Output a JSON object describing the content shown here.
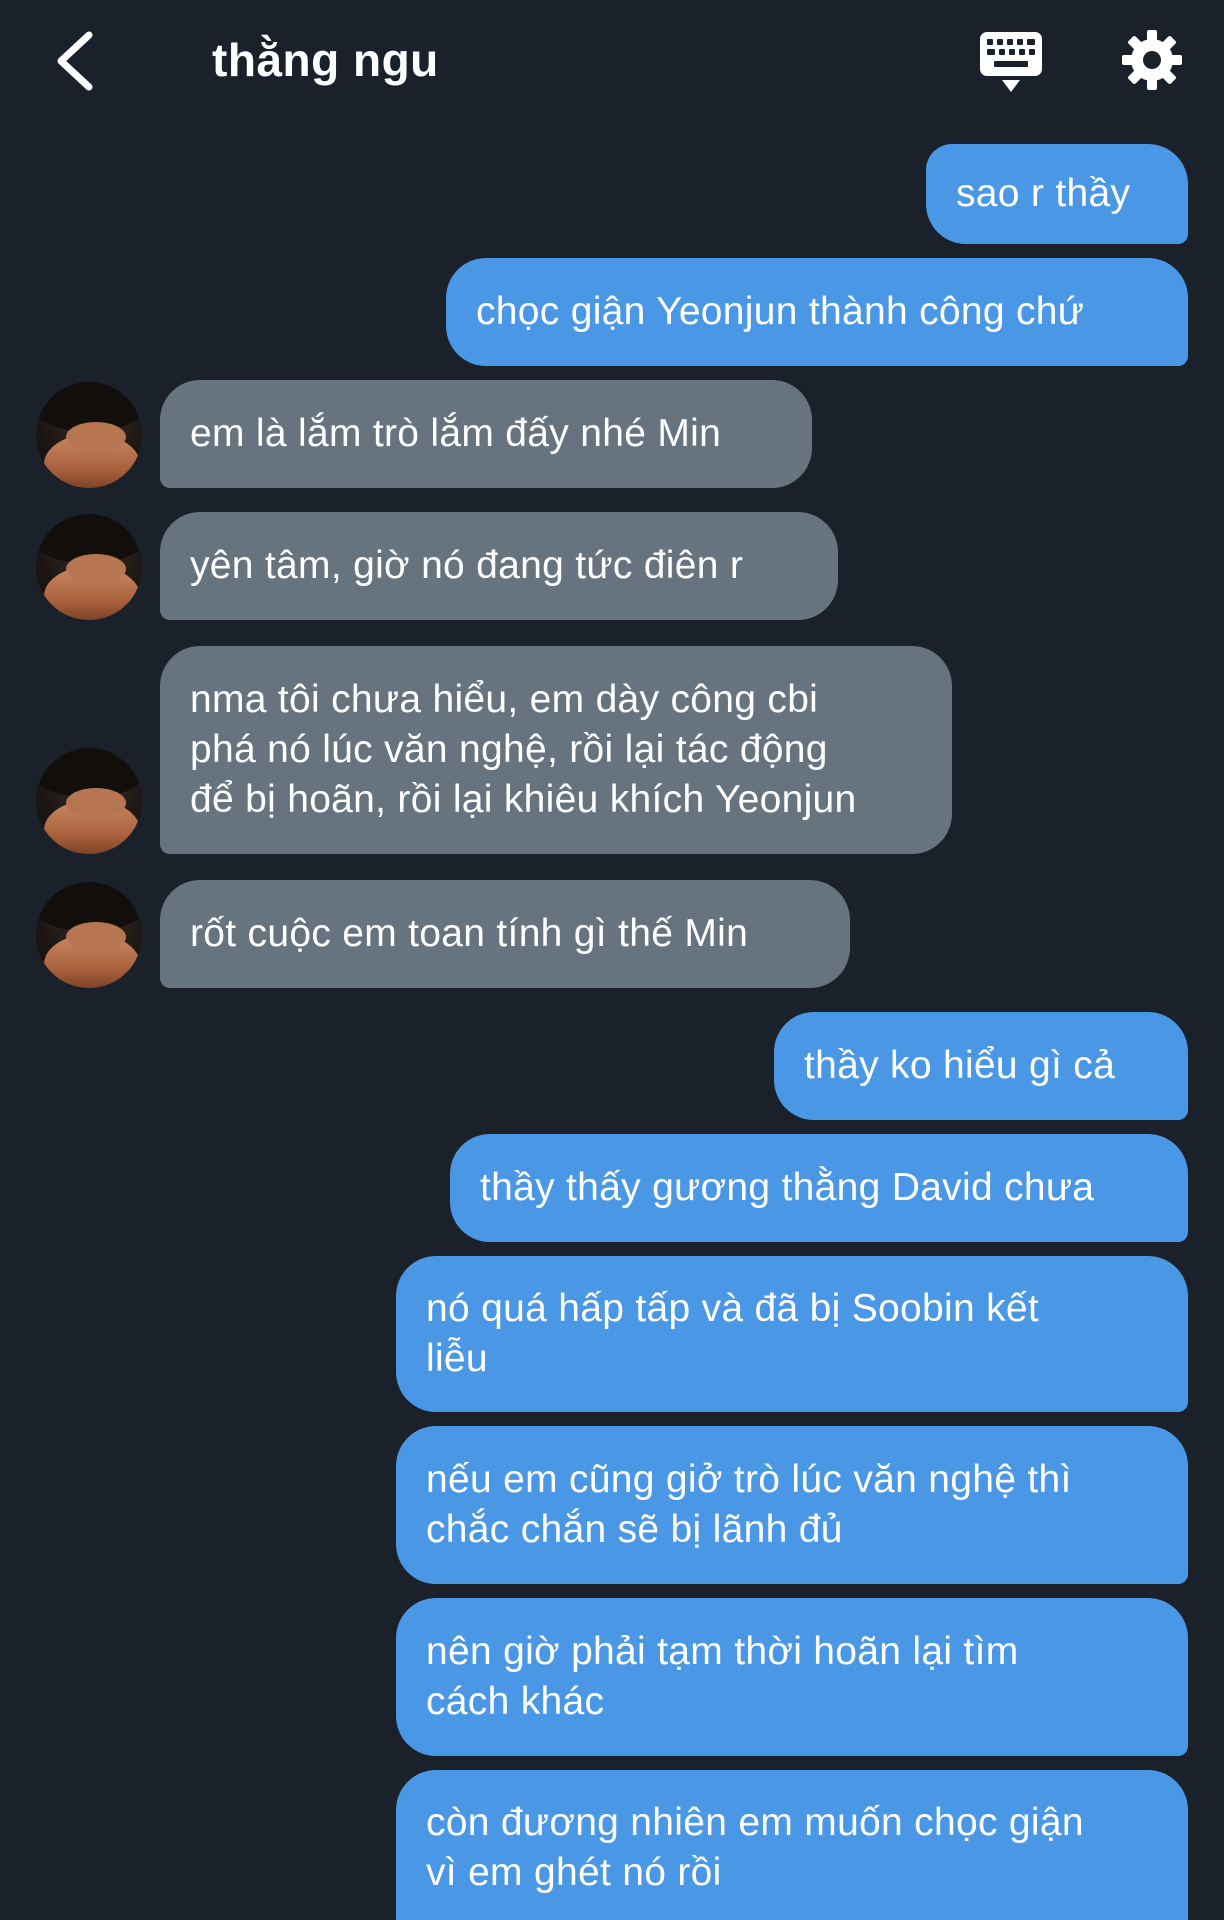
{
  "header": {
    "title": "thằng ngu",
    "back_icon": "chevron-left-icon",
    "keyboard_icon": "keyboard-icon",
    "settings_icon": "gear-icon"
  },
  "colors": {
    "background": "#1b212b",
    "outgoing_bubble": "#4a98e5",
    "incoming_bubble": "#67737f",
    "text": "#ffffff"
  },
  "messages": [
    {
      "direction": "out",
      "text": "sao r thầy"
    },
    {
      "direction": "out",
      "text": "chọc giận Yeonjun thành công chứ"
    },
    {
      "direction": "in",
      "text": "em là lắm trò lắm đấy nhé Min"
    },
    {
      "direction": "in",
      "text": "yên tâm, giờ nó đang tức điên r"
    },
    {
      "direction": "in",
      "text": "nma tôi chưa hiểu, em dày công cbi\nphá nó lúc văn nghệ, rồi lại tác động\nđể bị hoãn, rồi lại khiêu khích Yeonjun"
    },
    {
      "direction": "in",
      "text": "rốt cuộc em toan tính gì thế Min"
    },
    {
      "direction": "out",
      "text": "thầy ko hiểu gì cả"
    },
    {
      "direction": "out",
      "text": "thầy thấy gương thằng David chưa"
    },
    {
      "direction": "out",
      "text": "nó quá hấp tấp và đã bị Soobin kết\nliễu"
    },
    {
      "direction": "out",
      "text": "nếu em cũng giở trò lúc văn nghệ thì\nchắc chắn sẽ bị lãnh đủ"
    },
    {
      "direction": "out",
      "text": "nên giờ phải tạm thời hoãn lại tìm\ncách khác"
    },
    {
      "direction": "out",
      "text": "còn đương nhiên em muốn chọc giận\nvì em ghét nó rồi"
    }
  ]
}
